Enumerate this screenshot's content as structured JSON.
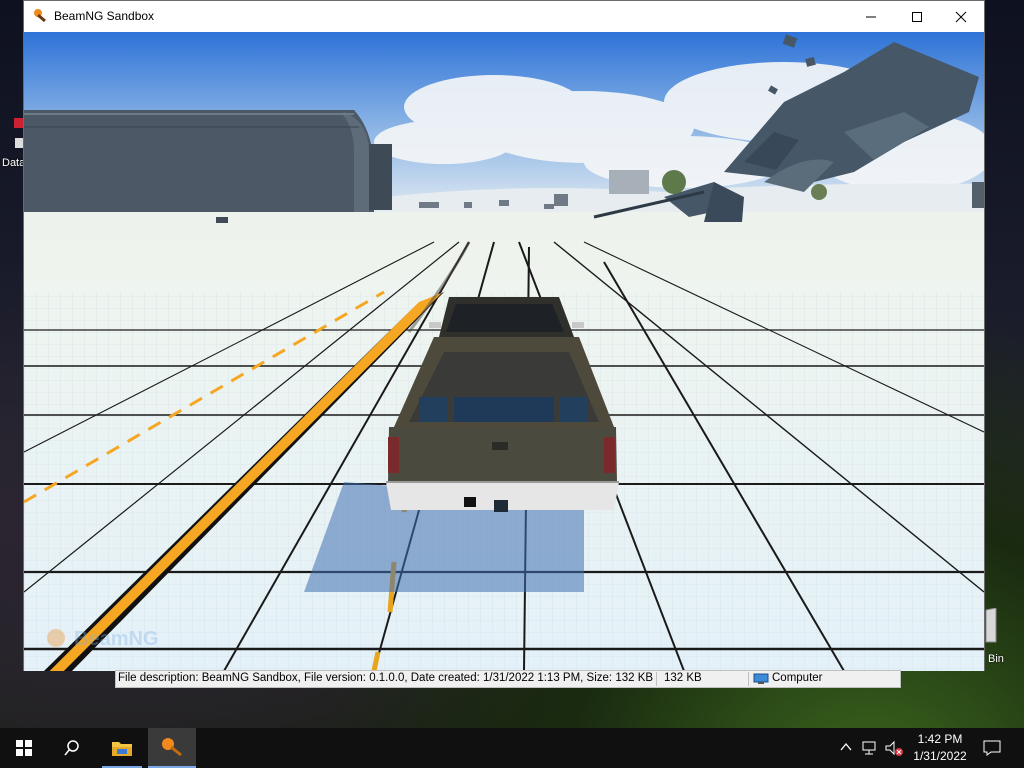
{
  "window": {
    "title": "BeamNG Sandbox",
    "controls": {
      "minimize": "—",
      "maximize": "☐",
      "close": "✕"
    }
  },
  "viewport": {
    "watermark": "BeamNG"
  },
  "description_bar": {
    "description": "File description: BeamNG Sandbox, File version: 0.1.0.0, Date created: 1/31/2022 1:13 PM, Size: 132 KB",
    "size": "132 KB",
    "location": "Computer"
  },
  "desktop": {
    "icon_label_left": "Data",
    "recycle_bin_label": "Bin"
  },
  "taskbar": {
    "clock_time": "1:42 PM",
    "clock_date": "1/31/2022"
  },
  "colors": {
    "grid_floor": "#e9f3f8",
    "hazard_orange": "#f5a623",
    "truck_body": "#4a4a3e",
    "sky_top": "#2b6fd6"
  }
}
